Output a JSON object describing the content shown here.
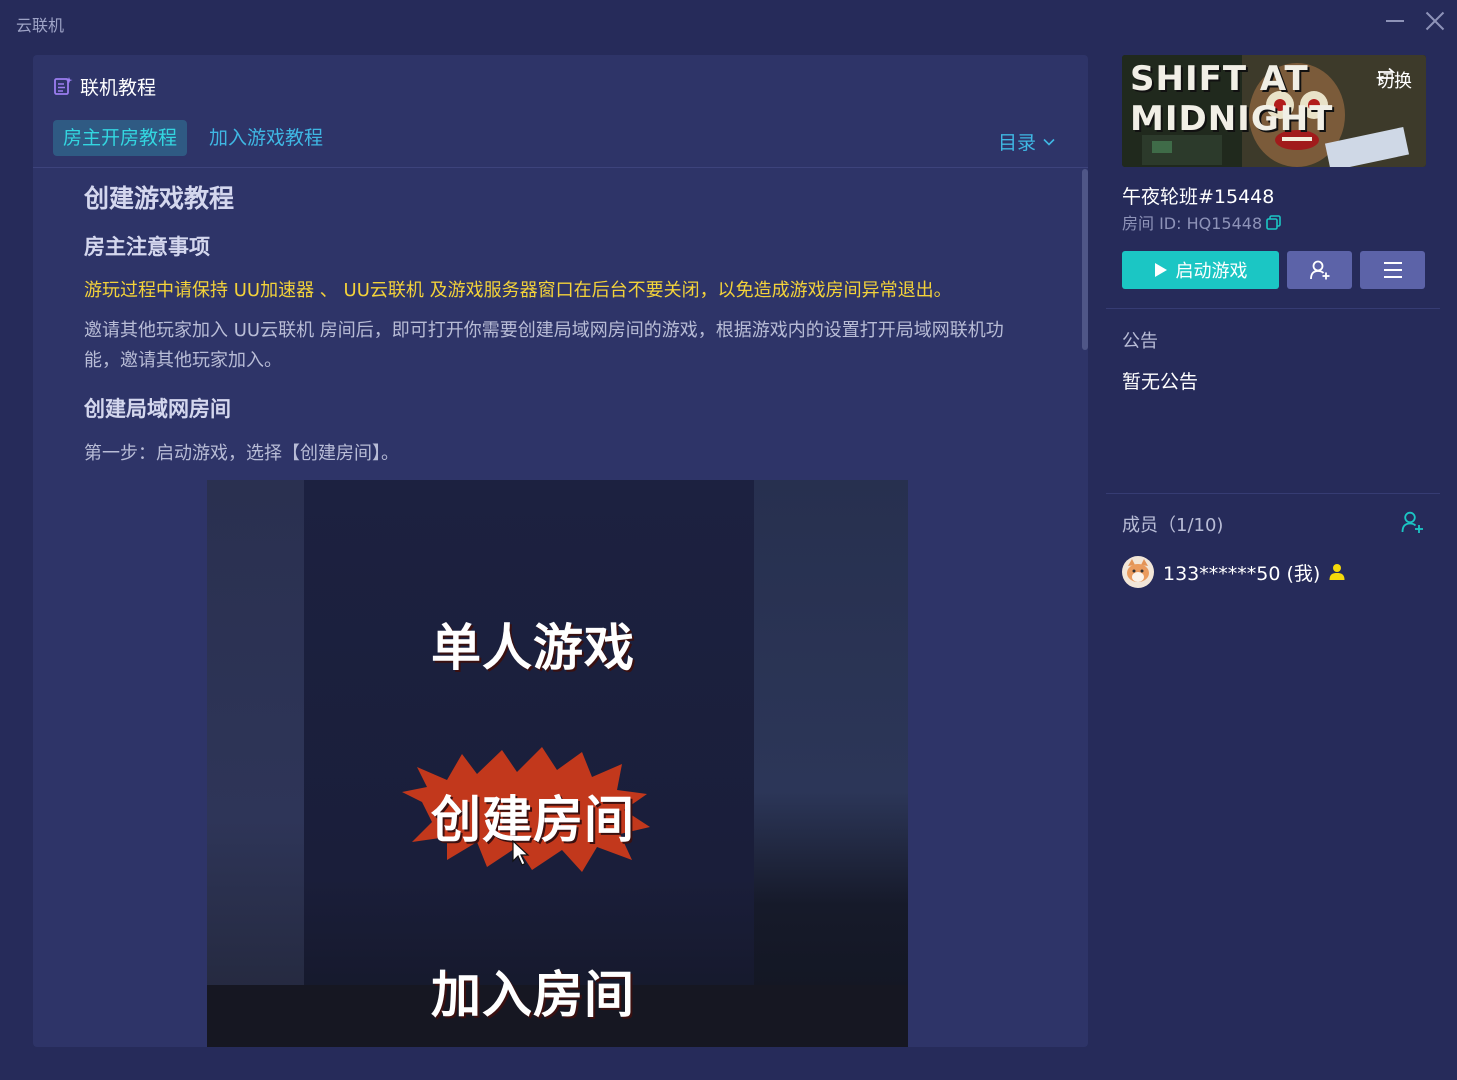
{
  "window": {
    "title": "云联机"
  },
  "tutorial": {
    "title": "联机教程",
    "tabs": [
      {
        "label": "房主开房教程",
        "active": true
      },
      {
        "label": "加入游戏教程",
        "active": false
      }
    ],
    "toc_label": "目录",
    "heading": "创建游戏教程",
    "section1_title": "房主注意事项",
    "warning": "游玩过程中请保持 UU加速器 、 UU云联机 及游戏服务器窗口在后台不要关闭，以免造成游戏房间异常退出。",
    "paragraph": "邀请其他玩家加入 UU云联机 房间后，即可打开你需要创建局域网房间的游戏，根据游戏内的设置打开局域网联机功能，邀请其他玩家加入。",
    "section2_title": "创建局域网房间",
    "step1": "第一步：启动游戏，选择【创建房间】。",
    "screenshot_menu": [
      "单人游戏",
      "创建房间",
      "加入房间"
    ]
  },
  "room": {
    "cover_logo_line1": "SHIFT AT",
    "cover_logo_line2": "MIDNIGHT",
    "switch_label": "切换",
    "name": "午夜轮班#15448",
    "id_label": "房间 ID: HQ15448",
    "launch_label": "启动游戏"
  },
  "notice": {
    "title": "公告",
    "body": "暂无公告"
  },
  "members": {
    "title": "成员（1/10)",
    "list": [
      {
        "name": "133******50 (我)",
        "is_owner": true
      }
    ]
  },
  "colors": {
    "accent": "#1bc6c4",
    "tab_text": "#33d6e0",
    "link": "#3fb7e3",
    "warning": "#f3d23a",
    "owner": "#f5d90a"
  }
}
